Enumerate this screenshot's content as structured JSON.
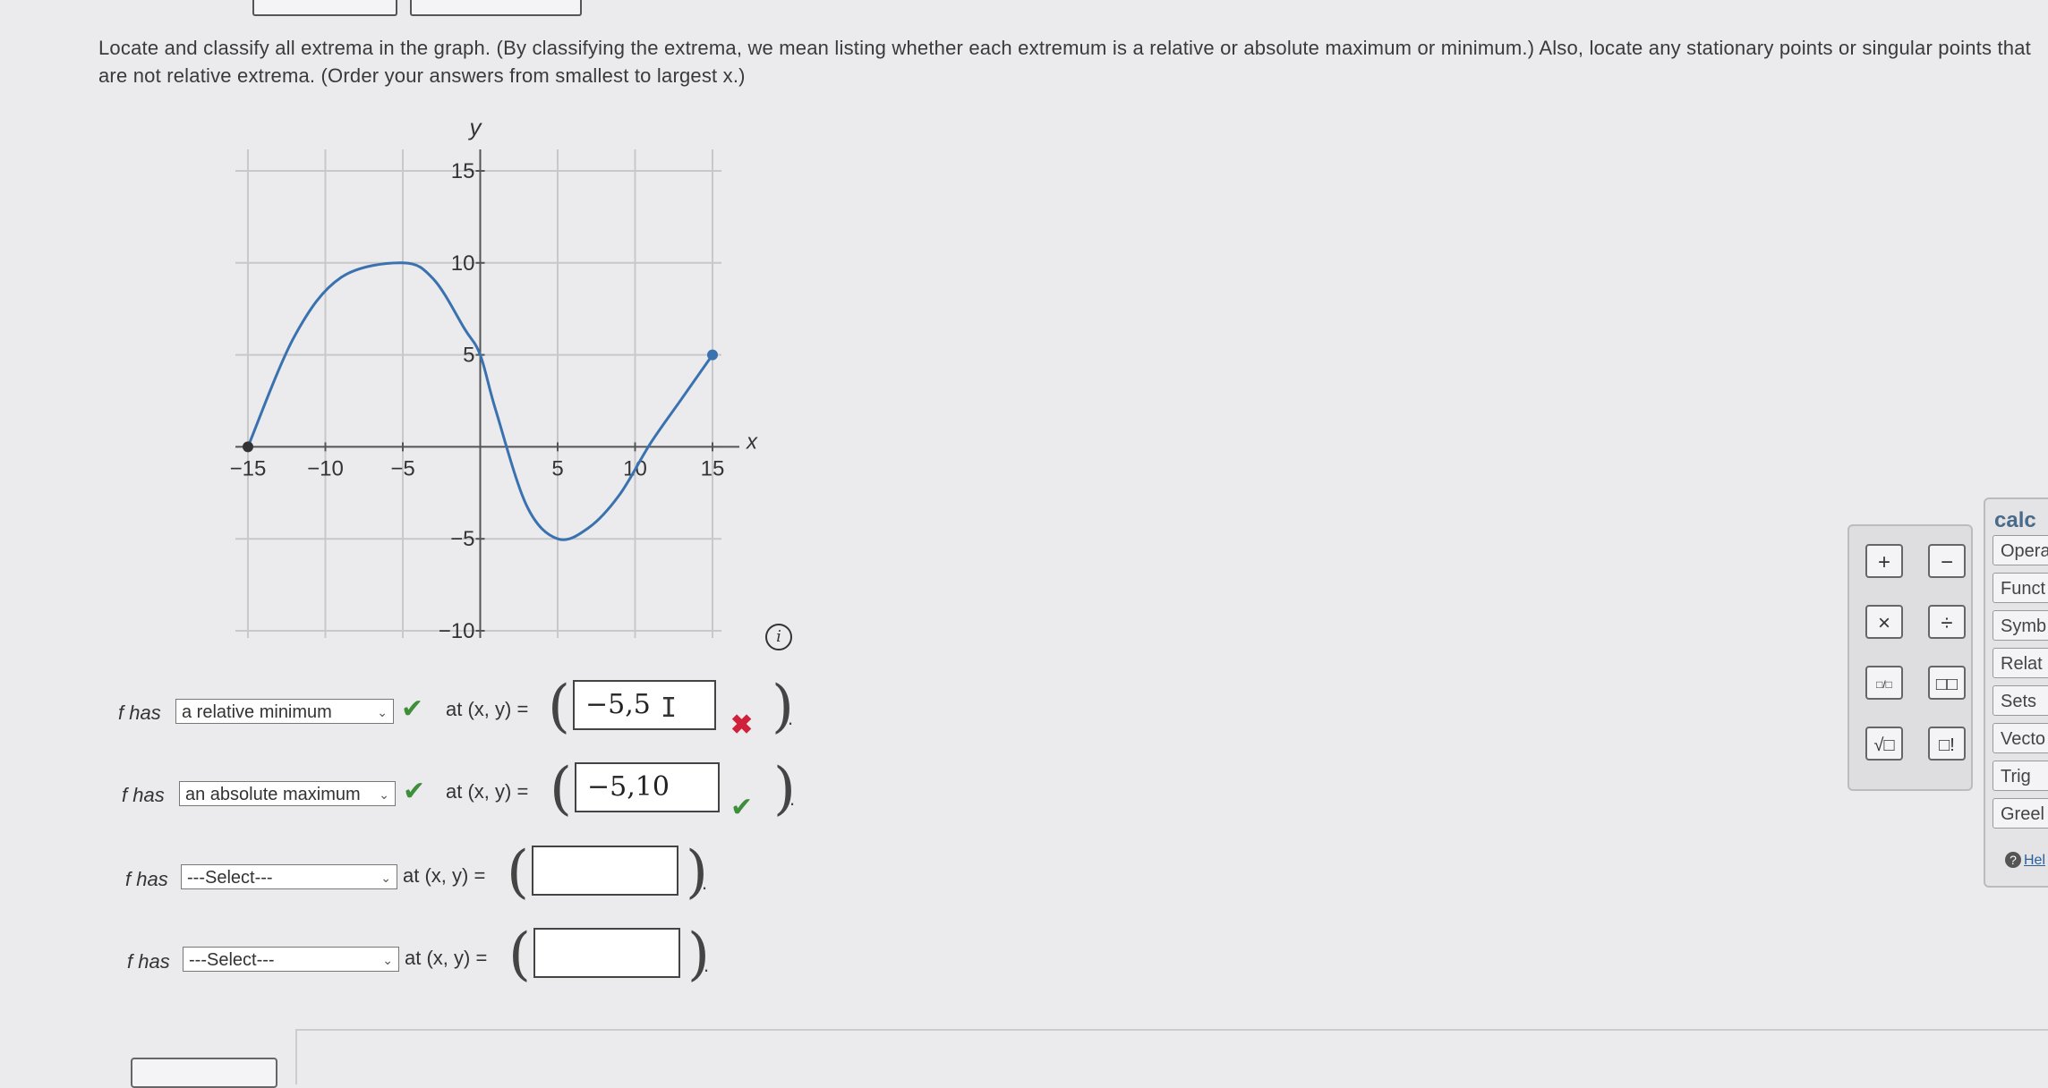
{
  "question": "Locate and classify all extrema in the graph. (By classifying the extrema, we mean listing whether each extremum is a relative or absolute maximum or minimum.) Also, locate any stationary points or singular points that are not relative extrema. (Order your answers from smallest to largest x.)",
  "graph": {
    "x_axis_label": "x",
    "y_axis_label": "y",
    "x_ticks": [
      "−15",
      "−10",
      "−5",
      "5",
      "10",
      "15"
    ],
    "y_ticks": [
      "15",
      "10",
      "5",
      "−5",
      "−10"
    ],
    "x_range": [
      -15,
      15
    ],
    "y_range": [
      -10,
      15
    ],
    "curve_color": "#3a72b0",
    "endpoints": [
      [
        -15,
        0
      ],
      [
        15,
        5
      ]
    ],
    "relative_max": [
      -5,
      10
    ],
    "relative_min": [
      5,
      -5
    ]
  },
  "answers": [
    {
      "prefix": "f has",
      "select": "a relative minimum",
      "at_label": "at (x, y) =",
      "value": "−5,5",
      "select_status": "correct",
      "value_status": "incorrect"
    },
    {
      "prefix": "f has",
      "select": "an absolute maximum",
      "at_label": "at (x, y) =",
      "value": "−5,10",
      "select_status": "correct",
      "value_status": "correct"
    },
    {
      "prefix": "f has",
      "select": "---Select---",
      "at_label": "at (x, y) =",
      "value": ""
    },
    {
      "prefix": "f has",
      "select": "---Select---",
      "at_label": "at (x, y) =",
      "value": ""
    }
  ],
  "keypad": [
    "+",
    "−",
    "×",
    "÷",
    "□/□",
    "□□",
    "√□",
    "□!"
  ],
  "calc_panel": {
    "title": "calc",
    "items": [
      "Opera",
      "Funct",
      "Symb",
      "Relat",
      "Sets",
      "Vecto",
      "Trig",
      "Greel"
    ],
    "help": "Hel"
  },
  "colors": {
    "check": "#3e8e3a",
    "error": "#d0213a"
  }
}
